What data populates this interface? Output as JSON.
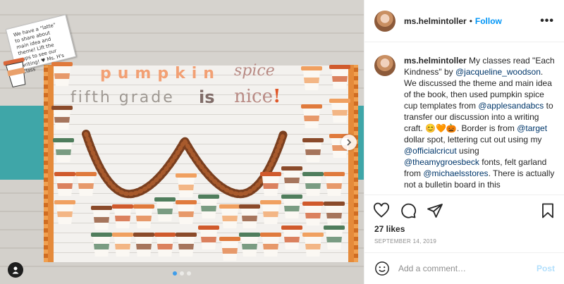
{
  "photo": {
    "note_text": "We have a \"latte\" to share about main idea and theme! Lift the cups to see our writing! ♥ Ms. H's Class",
    "board_letters": {
      "line1": "pumpkin",
      "line1b": "spice",
      "line2": "fifth grade",
      "line2b": "is",
      "line2c": "nice",
      "bang": "!"
    },
    "cup_text": "Pumpkin Spice",
    "carousel_dots": 3,
    "active_dot": 0
  },
  "header": {
    "username": "ms.helmintoller",
    "separator": "•",
    "follow_label": "Follow",
    "more_label": "•••"
  },
  "caption": {
    "username": "ms.helmintoller",
    "segments": [
      {
        "t": "My classes read \"Each Kindness\" by "
      },
      {
        "m": "@jacqueline_woodson"
      },
      {
        "t": ". We discussed the theme and main idea of the book, then used pumpkin spice cup templates from "
      },
      {
        "m": "@applesandabcs"
      },
      {
        "t": " to transfer our discussion into a writing craft. 😊🧡🎃. Border is from "
      },
      {
        "m": "@target"
      },
      {
        "t": " dollar spot, lettering cut out using my "
      },
      {
        "m": "@officialcricut"
      },
      {
        "t": " using "
      },
      {
        "m": "@theamygroesbeck"
      },
      {
        "t": " fonts, felt garland from "
      },
      {
        "m": "@michaelsstores"
      },
      {
        "t": ". There is actually not a bulletin board in this"
      }
    ]
  },
  "likes": "27 likes",
  "date": "SEPTEMBER 14, 2019",
  "comment": {
    "placeholder": "Add a comment…",
    "post_label": "Post"
  },
  "colors": {
    "accent_blue": "#0095f6",
    "teal_wall": "#3fa6a8",
    "border_orange": "#e58a3a"
  }
}
